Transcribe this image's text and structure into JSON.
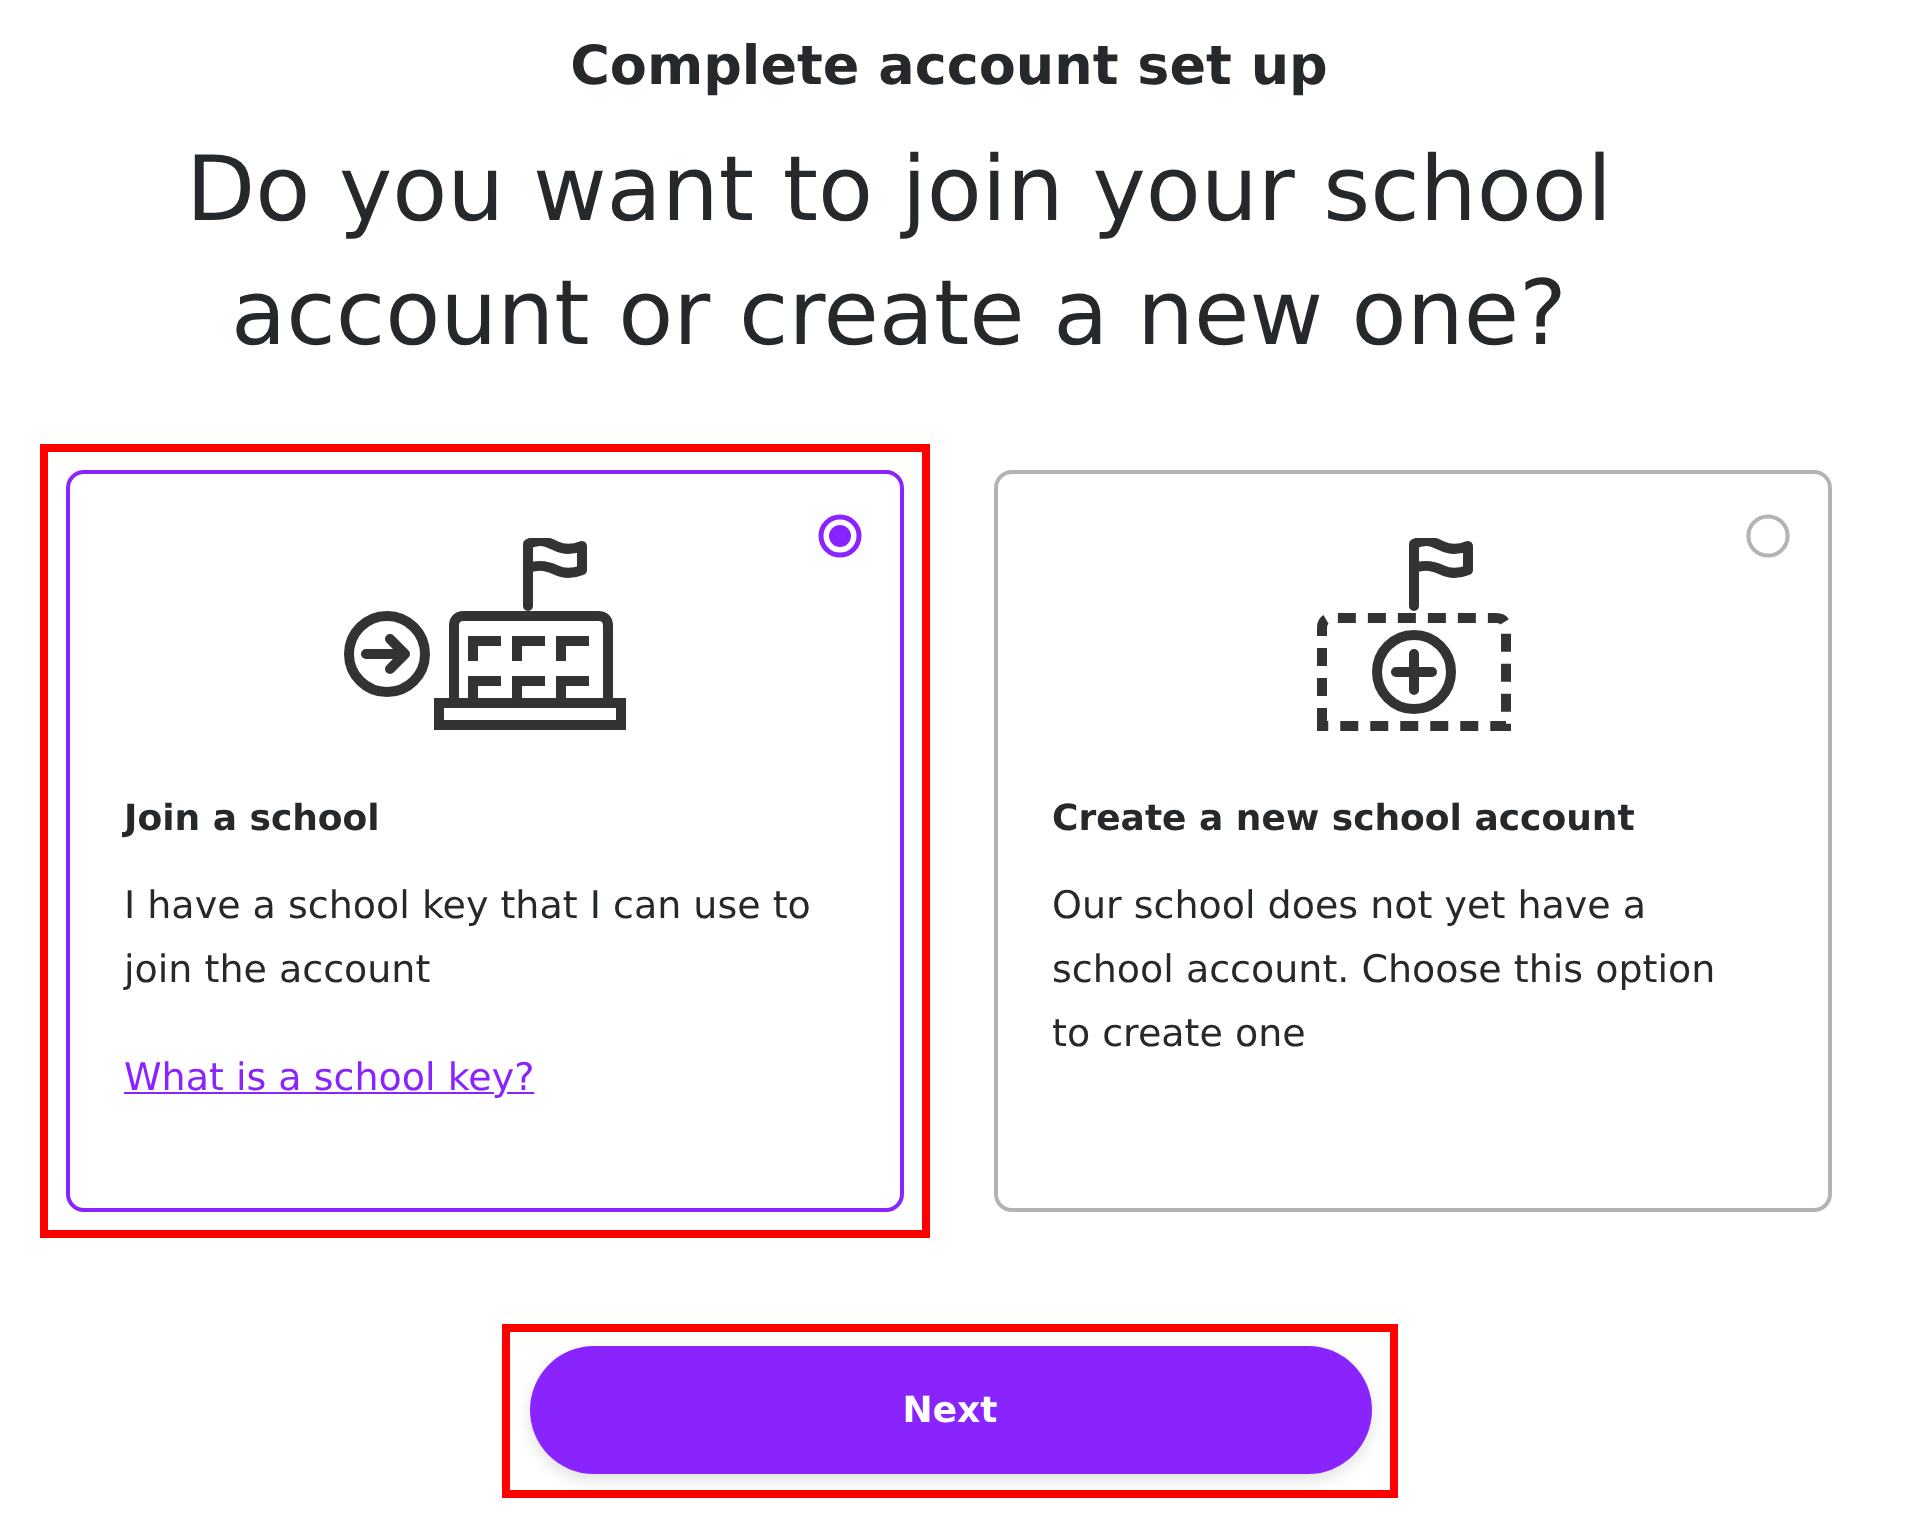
{
  "header": {
    "title": "Complete account set up",
    "question": "Do you want to join your school account or create a new one?"
  },
  "options": [
    {
      "kind": "join",
      "title": "Join a school",
      "description": "I have a school key that I can use to join the account",
      "link": "What is a school key?",
      "selected": true,
      "highlighted": true
    },
    {
      "kind": "create",
      "title": "Create a new school account",
      "description": "Our school does not yet have a school account. Choose this option to create one",
      "selected": false,
      "highlighted": false
    }
  ],
  "next_button": {
    "label": "Next",
    "highlighted": true
  }
}
